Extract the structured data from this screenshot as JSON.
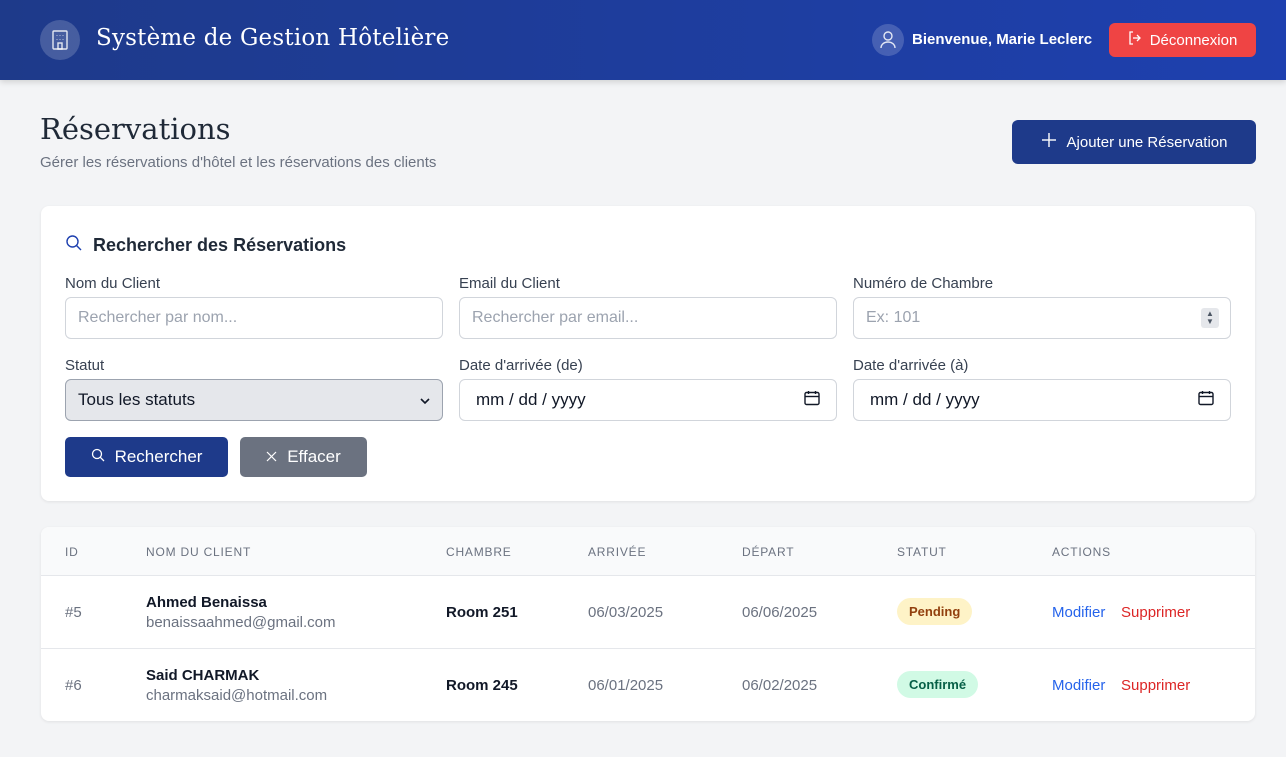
{
  "header": {
    "title": "Système de Gestion Hôtelière",
    "welcome": "Bienvenue, Marie Leclerc",
    "logout_label": "Déconnexion",
    "brand_icon": "building-icon",
    "user_icon": "user-icon",
    "logout_icon": "logout-icon"
  },
  "page": {
    "title": "Réservations",
    "subtitle": "Gérer les réservations d'hôtel et les réservations des clients",
    "add_label": "Ajouter une Réservation"
  },
  "search": {
    "heading": "Rechercher des Réservations",
    "client_name_label": "Nom du Client",
    "client_name_placeholder": "Rechercher par nom...",
    "client_name_value": "",
    "client_email_label": "Email du Client",
    "client_email_placeholder": "Rechercher par email...",
    "client_email_value": "",
    "room_number_label": "Numéro de Chambre",
    "room_number_placeholder": "Ex: 101",
    "room_number_value": "",
    "status_label": "Statut",
    "status_selected": "Tous les statuts",
    "arrival_from_label": "Date d'arrivée (de)",
    "arrival_from_value": "mm / dd / yyyy",
    "arrival_to_label": "Date d'arrivée (à)",
    "arrival_to_value": "mm / dd / yyyy",
    "search_label": "Rechercher",
    "clear_label": "Effacer"
  },
  "table": {
    "headers": [
      "ID",
      "NOM DU CLIENT",
      "CHAMBRE",
      "ARRIVÉE",
      "DÉPART",
      "STATUT",
      "ACTIONS"
    ],
    "rows": [
      {
        "id": "#5",
        "name": "Ahmed Benaissa",
        "email": "benaissaahmed@gmail.com",
        "room": "Room 251",
        "arrival": "06/03/2025",
        "departure": "06/06/2025",
        "status": "Pending",
        "edit": "Modifier",
        "delete": "Supprimer"
      },
      {
        "id": "#6",
        "name": "Said CHARMAK",
        "email": "charmaksaid@hotmail.com",
        "room": "Room 245",
        "arrival": "06/01/2025",
        "departure": "06/02/2025",
        "status": "Confirmé",
        "edit": "Modifier",
        "delete": "Supprimer"
      }
    ]
  },
  "colors": {
    "primary": "#1e3a8a",
    "danger": "#ef4444",
    "pending_bg": "#fef3c7",
    "pending_text": "#92400e",
    "confirmed_bg": "#d1fae5",
    "confirmed_text": "#065f46",
    "link_edit": "#2563eb",
    "link_delete": "#dc2626"
  }
}
